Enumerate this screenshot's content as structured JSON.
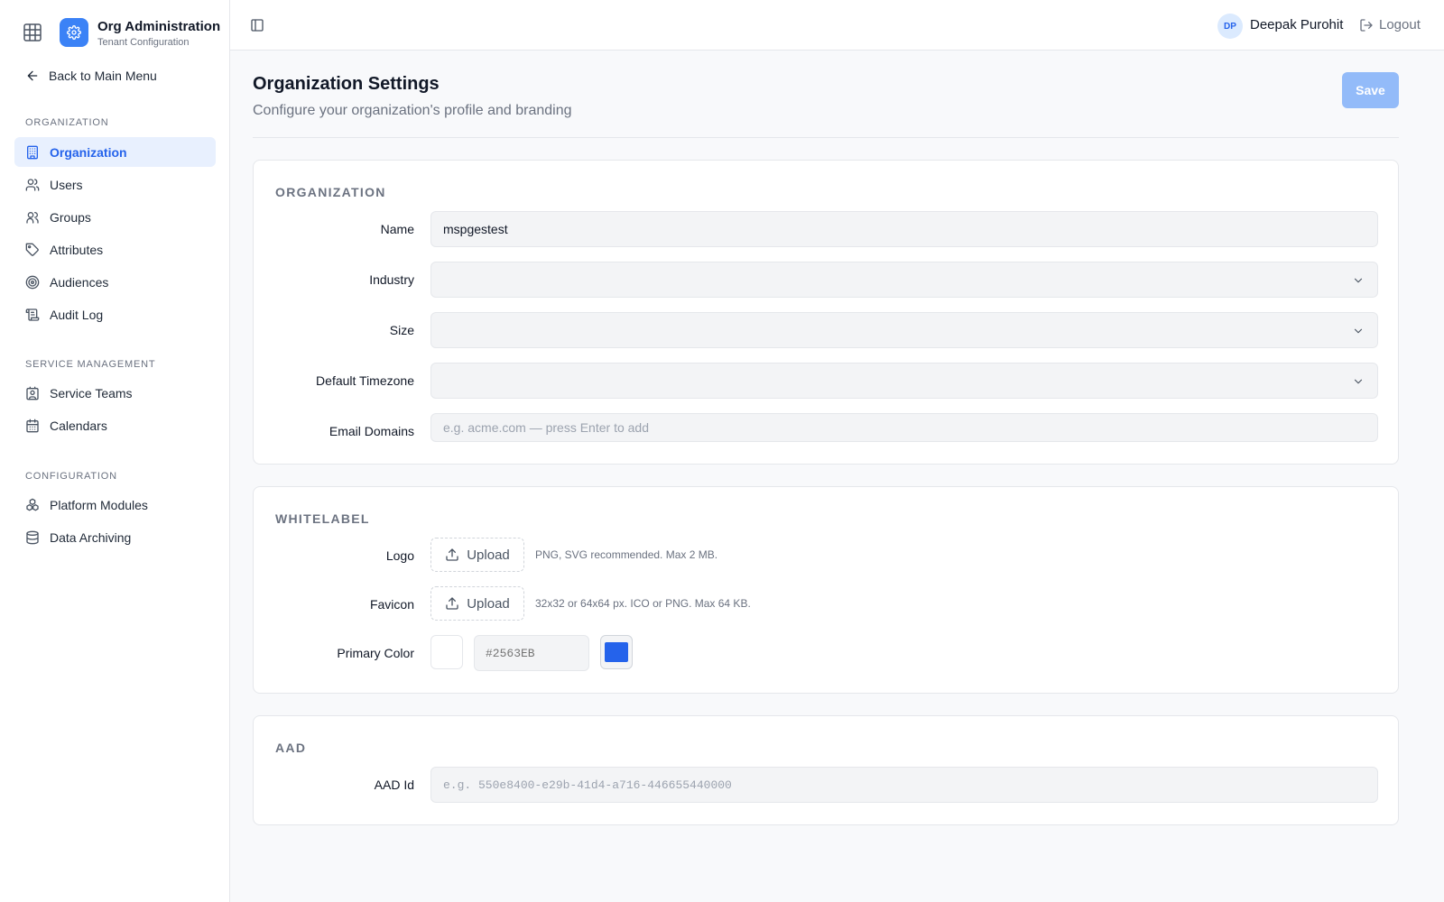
{
  "app": {
    "title": "Org Administration",
    "subtitle": "Tenant Configuration",
    "back_label": "Back to Main Menu"
  },
  "sidebar": {
    "sections": [
      {
        "label": "ORGANIZATION",
        "items": [
          {
            "label": "Organization",
            "icon": "building-icon",
            "active": true
          },
          {
            "label": "Users",
            "icon": "users-icon"
          },
          {
            "label": "Groups",
            "icon": "groups-icon"
          },
          {
            "label": "Attributes",
            "icon": "tag-icon"
          },
          {
            "label": "Audiences",
            "icon": "target-icon"
          },
          {
            "label": "Audit Log",
            "icon": "scroll-icon"
          }
        ]
      },
      {
        "label": "SERVICE MANAGEMENT",
        "items": [
          {
            "label": "Service Teams",
            "icon": "contact-icon"
          },
          {
            "label": "Calendars",
            "icon": "calendar-icon"
          }
        ]
      },
      {
        "label": "CONFIGURATION",
        "items": [
          {
            "label": "Platform Modules",
            "icon": "modules-icon"
          },
          {
            "label": "Data Archiving",
            "icon": "database-icon"
          }
        ]
      }
    ]
  },
  "topbar": {
    "user_initials": "DP",
    "user_name": "Deepak Purohit",
    "logout_label": "Logout"
  },
  "page": {
    "title": "Organization Settings",
    "subtitle": "Configure your organization's profile and branding",
    "save_label": "Save"
  },
  "organization": {
    "section_label": "ORGANIZATION",
    "name_label": "Name",
    "name_value": "mspgestest",
    "industry_label": "Industry",
    "industry_value": "",
    "size_label": "Size",
    "size_value": "",
    "timezone_label": "Default Timezone",
    "timezone_value": "",
    "email_domains_label": "Email Domains",
    "email_domains_placeholder": "e.g. acme.com — press Enter to add"
  },
  "whitelabel": {
    "section_label": "WHITELABEL",
    "logo_label": "Logo",
    "logo_upload": "Upload",
    "logo_hint": "PNG, SVG recommended. Max 2 MB.",
    "favicon_label": "Favicon",
    "favicon_upload": "Upload",
    "favicon_hint": "32x32 or 64x64 px. ICO or PNG. Max 64 KB.",
    "primary_color_label": "Primary Color",
    "primary_color_placeholder": "#2563EB",
    "primary_color": "#2563EB"
  },
  "aad": {
    "section_label": "AAD",
    "aad_id_label": "AAD Id",
    "aad_id_placeholder": "e.g. 550e8400-e29b-41d4-a716-446655440000"
  }
}
